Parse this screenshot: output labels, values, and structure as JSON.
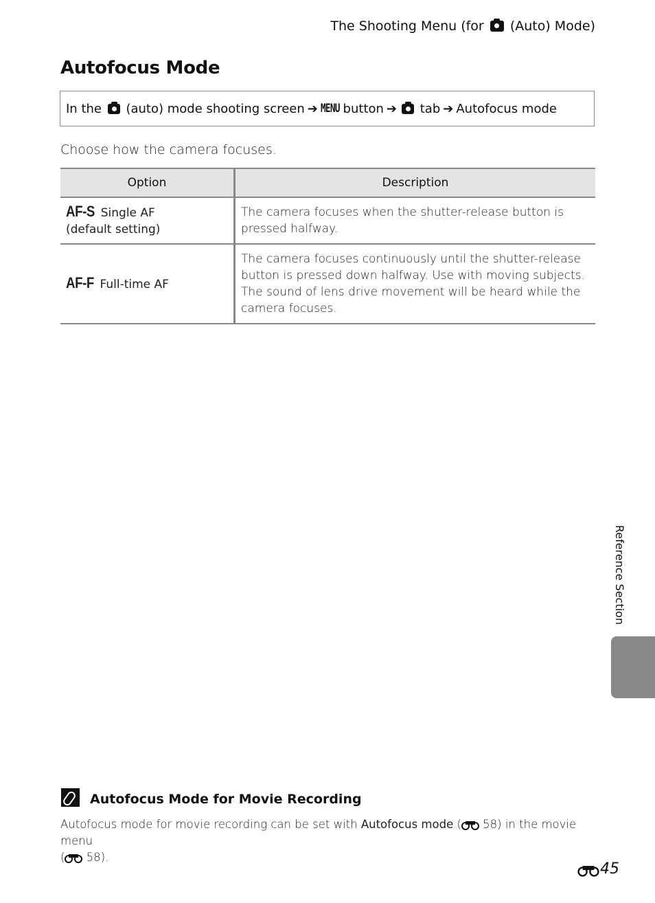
{
  "running_head": {
    "prefix": "The Shooting Menu (for",
    "icon": "camera-icon",
    "suffix": "(Auto) Mode)"
  },
  "title": "Autofocus Mode",
  "nav_path": {
    "part1": "In the",
    "part2": "(auto) mode shooting screen",
    "arrow": "➔",
    "menu_glyph": "MENU",
    "part3": "button",
    "part4": "tab",
    "part5": "Autofocus mode"
  },
  "intro": "Choose how the camera focuses.",
  "table": {
    "headers": [
      "Option",
      "Description"
    ],
    "rows": [
      {
        "code": "AF-S",
        "label": "Single AF",
        "sublabel": "(default setting)",
        "description": "The camera focuses when the shutter-release button is pressed halfway."
      },
      {
        "code": "AF-F",
        "label": "Full-time AF",
        "sublabel": "",
        "description": "The camera focuses continuously until the shutter-release button is pressed down halfway. Use with moving subjects. The sound of lens drive movement will be heard while the camera focuses."
      }
    ]
  },
  "side_tab": {
    "label": "Reference Section",
    "color": "#888888"
  },
  "note": {
    "icon": "note-paperclip-icon",
    "title": "Autofocus Mode for Movie Recording",
    "body_prefix": "Autofocus mode for movie recording can be set with",
    "body_bold": "Autofocus mode",
    "ref1": "58",
    "body_mid": "in the movie menu",
    "ref2": "58"
  },
  "page_number": "45"
}
